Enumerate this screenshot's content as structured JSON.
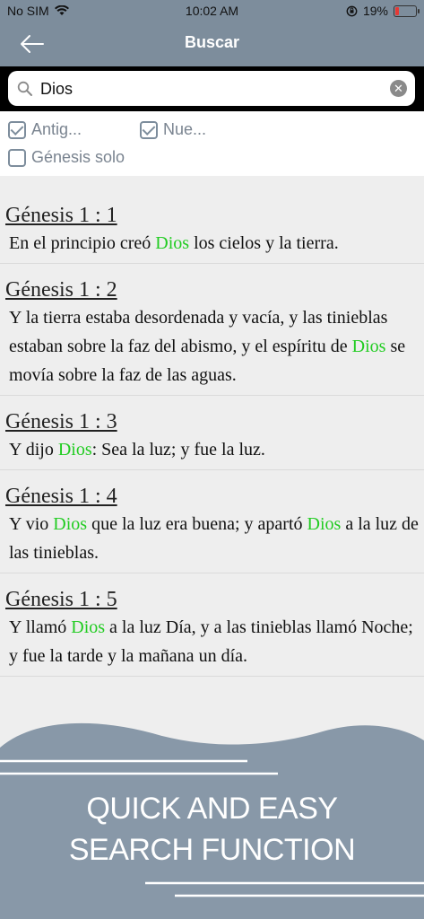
{
  "status_bar": {
    "carrier": "No SIM",
    "time": "10:02 AM",
    "battery_percent": "19%",
    "battery_level": 0.19
  },
  "nav": {
    "title": "Buscar",
    "back_icon": "arrow-left-icon"
  },
  "search": {
    "value": "Dios"
  },
  "filters": [
    {
      "label": "Antig...",
      "checked": true
    },
    {
      "label": "Nue...",
      "checked": true
    },
    {
      "label": "Génesis solo",
      "checked": false
    }
  ],
  "results": [
    {
      "ref": "Génesis 1 : 1",
      "parts": [
        " En el principio creó ",
        "Dios",
        " los cielos y la tierra."
      ]
    },
    {
      "ref": "Génesis 1 : 2",
      "parts": [
        " Y la tierra estaba desordenada y vacía, y las tinieblas estaban sobre la faz del abismo, y el espíritu de ",
        "Dios",
        " se movía sobre la faz de las aguas."
      ]
    },
    {
      "ref": "Génesis 1 : 3",
      "parts": [
        " Y dijo ",
        "Dios",
        ": Sea la luz; y fue la luz."
      ]
    },
    {
      "ref": "Génesis 1 : 4",
      "parts": [
        " Y vio ",
        "Dios",
        " que la luz era buena; y apartó ",
        "Dios",
        " a la luz de las tinieblas."
      ]
    },
    {
      "ref": "Génesis 1 : 5",
      "parts": [
        " Y llamó ",
        "Dios",
        " a la luz Día, y a las tinieblas llamó Noche; y fue la tarde y la mañana un día."
      ]
    }
  ],
  "promo": {
    "line1": "QUICK AND EASY",
    "line2": "SEARCH FUNCTION"
  },
  "colors": {
    "header": "#7d8d9c",
    "highlight": "#22cc22",
    "promo": "#8898a8"
  }
}
